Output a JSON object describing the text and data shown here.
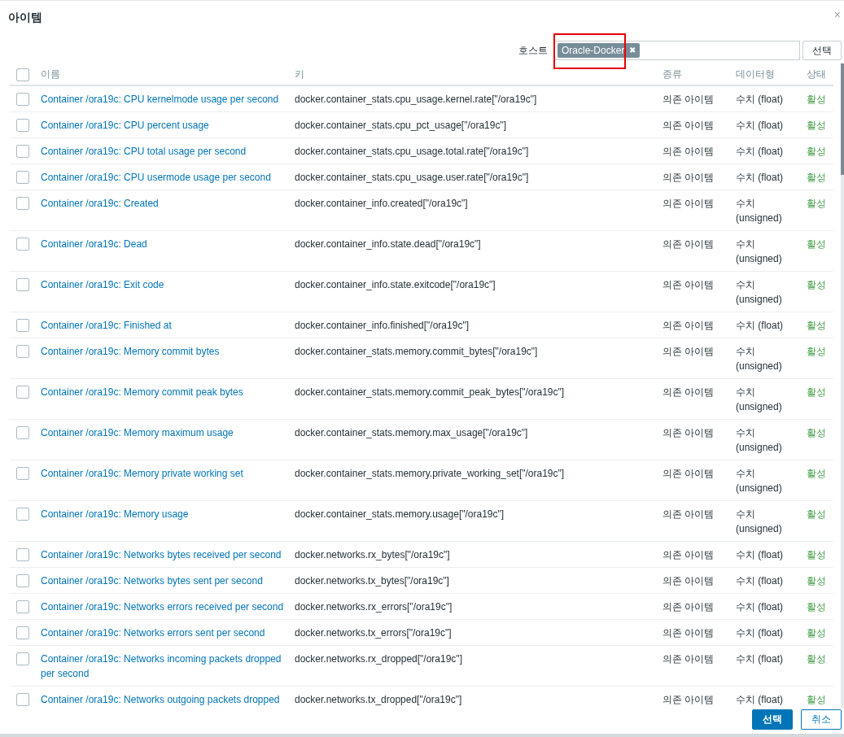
{
  "dialog": {
    "title": "아이템",
    "close": "×"
  },
  "host_filter": {
    "label": "호스트",
    "tags": [
      {
        "label": "Oracle-Docker",
        "remove": "✖",
        "highlighted": true
      }
    ],
    "select_button": "선택"
  },
  "table": {
    "select_all": {
      "checked": false
    },
    "columns": [
      "이름",
      "키",
      "종류",
      "데이터형",
      "상태"
    ],
    "rows": [
      {
        "checked": false,
        "name": "Container /ora19c: CPU kernelmode usage per second",
        "key": "docker.container_stats.cpu_usage.kernel.rate[\"/ora19c\"]",
        "type": "의존 아이템",
        "data_type": "수치 (float)",
        "status": "활성"
      },
      {
        "checked": false,
        "name": "Container /ora19c: CPU percent usage",
        "key": "docker.container_stats.cpu_pct_usage[\"/ora19c\"]",
        "type": "의존 아이템",
        "data_type": "수치 (float)",
        "status": "활성"
      },
      {
        "checked": false,
        "name": "Container /ora19c: CPU total usage per second",
        "key": "docker.container_stats.cpu_usage.total.rate[\"/ora19c\"]",
        "type": "의존 아이템",
        "data_type": "수치 (float)",
        "status": "활성"
      },
      {
        "checked": false,
        "name": "Container /ora19c: CPU usermode usage per second",
        "key": "docker.container_stats.cpu_usage.user.rate[\"/ora19c\"]",
        "type": "의존 아이템",
        "data_type": "수치 (float)",
        "status": "활성"
      },
      {
        "checked": false,
        "name": "Container /ora19c: Created",
        "key": "docker.container_info.created[\"/ora19c\"]",
        "type": "의존 아이템",
        "data_type": "수치 (unsigned)",
        "status": "활성"
      },
      {
        "checked": false,
        "name": "Container /ora19c: Dead",
        "key": "docker.container_info.state.dead[\"/ora19c\"]",
        "type": "의존 아이템",
        "data_type": "수치 (unsigned)",
        "status": "활성"
      },
      {
        "checked": false,
        "name": "Container /ora19c: Exit code",
        "key": "docker.container_info.state.exitcode[\"/ora19c\"]",
        "type": "의존 아이템",
        "data_type": "수치 (unsigned)",
        "status": "활성"
      },
      {
        "checked": false,
        "name": "Container /ora19c: Finished at",
        "key": "docker.container_info.finished[\"/ora19c\"]",
        "type": "의존 아이템",
        "data_type": "수치 (float)",
        "status": "활성"
      },
      {
        "checked": false,
        "name": "Container /ora19c: Memory commit bytes",
        "key": "docker.container_stats.memory.commit_bytes[\"/ora19c\"]",
        "type": "의존 아이템",
        "data_type": "수치 (unsigned)",
        "status": "활성"
      },
      {
        "checked": false,
        "name": "Container /ora19c: Memory commit peak bytes",
        "key": "docker.container_stats.memory.commit_peak_bytes[\"/ora19c\"]",
        "type": "의존 아이템",
        "data_type": "수치 (unsigned)",
        "status": "활성"
      },
      {
        "checked": false,
        "name": "Container /ora19c: Memory maximum usage",
        "key": "docker.container_stats.memory.max_usage[\"/ora19c\"]",
        "type": "의존 아이템",
        "data_type": "수치 (unsigned)",
        "status": "활성"
      },
      {
        "checked": false,
        "name": "Container /ora19c: Memory private working set",
        "key": "docker.container_stats.memory.private_working_set[\"/ora19c\"]",
        "type": "의존 아이템",
        "data_type": "수치 (unsigned)",
        "status": "활성"
      },
      {
        "checked": false,
        "name": "Container /ora19c: Memory usage",
        "key": "docker.container_stats.memory.usage[\"/ora19c\"]",
        "type": "의존 아이템",
        "data_type": "수치 (unsigned)",
        "status": "활성"
      },
      {
        "checked": false,
        "name": "Container /ora19c: Networks bytes received per second",
        "key": "docker.networks.rx_bytes[\"/ora19c\"]",
        "type": "의존 아이템",
        "data_type": "수치 (float)",
        "status": "활성"
      },
      {
        "checked": false,
        "name": "Container /ora19c: Networks bytes sent per second",
        "key": "docker.networks.tx_bytes[\"/ora19c\"]",
        "type": "의존 아이템",
        "data_type": "수치 (float)",
        "status": "활성"
      },
      {
        "checked": false,
        "name": "Container /ora19c: Networks errors received per second",
        "key": "docker.networks.rx_errors[\"/ora19c\"]",
        "type": "의존 아이템",
        "data_type": "수치 (float)",
        "status": "활성"
      },
      {
        "checked": false,
        "name": "Container /ora19c: Networks errors sent per second",
        "key": "docker.networks.tx_errors[\"/ora19c\"]",
        "type": "의존 아이템",
        "data_type": "수치 (float)",
        "status": "활성"
      },
      {
        "checked": false,
        "name": "Container /ora19c: Networks incoming packets dropped per second",
        "key": "docker.networks.rx_dropped[\"/ora19c\"]",
        "type": "의존 아이템",
        "data_type": "수치 (float)",
        "status": "활성"
      },
      {
        "checked": false,
        "name": "Container /ora19c: Networks outgoing packets dropped",
        "key": "docker.networks.tx_dropped[\"/ora19c\"]",
        "type": "의존 아이템",
        "data_type": "수치 (float)",
        "status": "활성"
      }
    ]
  },
  "footer": {
    "buttons": [
      {
        "label": "선택",
        "kind": "primary"
      },
      {
        "label": "취소",
        "kind": "secondary"
      }
    ]
  }
}
